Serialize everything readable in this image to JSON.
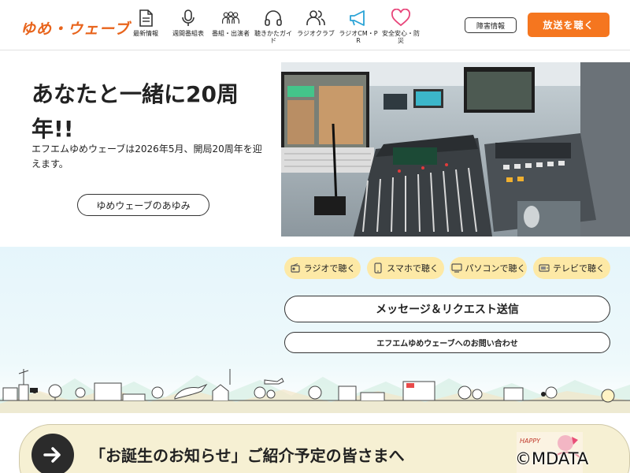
{
  "header": {
    "logo": "ゆめ・ウェーブ",
    "nav": [
      {
        "label": "最新情報",
        "icon": "document-icon"
      },
      {
        "label": "週間番組表",
        "icon": "microphone-icon"
      },
      {
        "label": "番組・出演者",
        "icon": "people-icon"
      },
      {
        "label": "聴きかたガイド",
        "icon": "headphones-icon"
      },
      {
        "label": "ラジオクラブ",
        "icon": "user-group-icon"
      },
      {
        "label": "ラジオCM・PR",
        "icon": "megaphone-icon"
      },
      {
        "label": "安全安心・防災",
        "icon": "heart-icon"
      }
    ],
    "accessibility_label": "障害情報",
    "listen_label": "放送を聴く",
    "colors": {
      "brand": "#e8641c",
      "listen_button": "#f5761f",
      "heart": "#e8457a",
      "megaphone": "#29a3d6"
    }
  },
  "hero": {
    "title": "あなたと一緒に20周年!!",
    "description": "エフエムゆめウェーブは2026年5月、開局20周年を迎えます。",
    "history_button": "ゆめウェーブのあゆみ"
  },
  "listen": {
    "pills": [
      {
        "label": "ラジオで聴く",
        "icon": "radio-icon"
      },
      {
        "label": "スマホで聴く",
        "icon": "smartphone-icon"
      },
      {
        "label": "パソコンで聴く",
        "icon": "monitor-icon"
      },
      {
        "label": "テレビで聴く",
        "icon": "tv-icon"
      }
    ],
    "pill_color": "#fde9a6",
    "message_button": "メッセージ＆リクエスト送信",
    "contact_button": "エフエムゆめウェーブへのお問い合わせ"
  },
  "banner": {
    "text": "「お誕生のお知らせ」ご紹介予定の皆さまへ",
    "thumb_text": "HAPPY"
  },
  "watermark": "©MDATA"
}
